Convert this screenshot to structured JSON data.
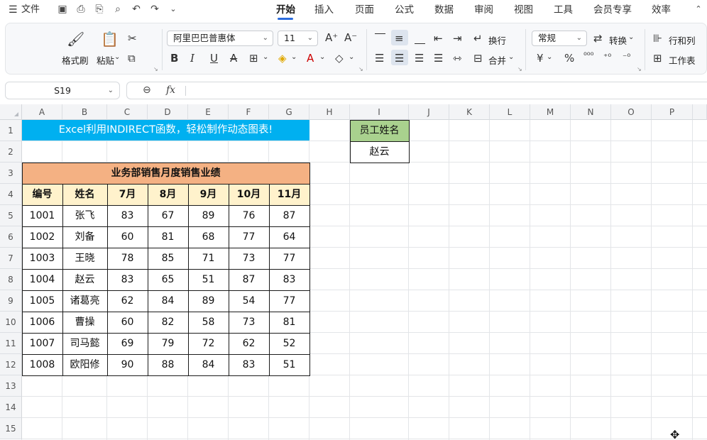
{
  "menubar": {
    "file_label": "文件",
    "tabs": [
      "开始",
      "插入",
      "页面",
      "公式",
      "数据",
      "审阅",
      "视图",
      "工具",
      "会员专享",
      "效率"
    ],
    "active_tab": "开始"
  },
  "ribbon": {
    "format_painter": "格式刷",
    "paste": "粘贴",
    "font_name": "阿里巴巴普惠体",
    "font_size": "11",
    "wrap": "换行",
    "merge": "合并",
    "number_format": "常规",
    "convert": "转换",
    "row_col": "行和列",
    "worksheet": "工作表"
  },
  "formula_bar": {
    "name_box": "S19",
    "fx_label": "fx",
    "formula": ""
  },
  "columns": [
    "A",
    "B",
    "C",
    "D",
    "E",
    "F",
    "G",
    "H",
    "I",
    "J",
    "K",
    "L",
    "M",
    "N",
    "O",
    "P"
  ],
  "rows": [
    "1",
    "2",
    "3",
    "4",
    "5",
    "6",
    "7",
    "8",
    "9",
    "10",
    "11",
    "12",
    "13",
    "14",
    "15"
  ],
  "sheet": {
    "banner": "Excel利用INDIRECT函数，轻松制作动态图表!",
    "table_title": "业务部销售月度销售业绩",
    "headers": [
      "编号",
      "姓名",
      "7月",
      "8月",
      "9月",
      "10月",
      "11月"
    ],
    "data": [
      [
        "1001",
        "张飞",
        "83",
        "67",
        "89",
        "76",
        "87"
      ],
      [
        "1002",
        "刘备",
        "60",
        "81",
        "68",
        "77",
        "64"
      ],
      [
        "1003",
        "王晓",
        "78",
        "85",
        "71",
        "73",
        "77"
      ],
      [
        "1004",
        "赵云",
        "83",
        "65",
        "51",
        "87",
        "83"
      ],
      [
        "1005",
        "诸葛亮",
        "62",
        "84",
        "89",
        "54",
        "77"
      ],
      [
        "1006",
        "曹操",
        "60",
        "82",
        "58",
        "73",
        "81"
      ],
      [
        "1007",
        "司马懿",
        "69",
        "79",
        "72",
        "62",
        "52"
      ],
      [
        "1008",
        "欧阳修",
        "90",
        "88",
        "84",
        "83",
        "51"
      ]
    ],
    "lookup_label": "员工姓名",
    "lookup_value": "赵云"
  },
  "colors": {
    "banner_bg": "#00b0f0",
    "title_bg": "#f4b183",
    "header_bg": "#fff2cc",
    "lookup_bg": "#a9d18e",
    "accent": "#2b6cde"
  }
}
